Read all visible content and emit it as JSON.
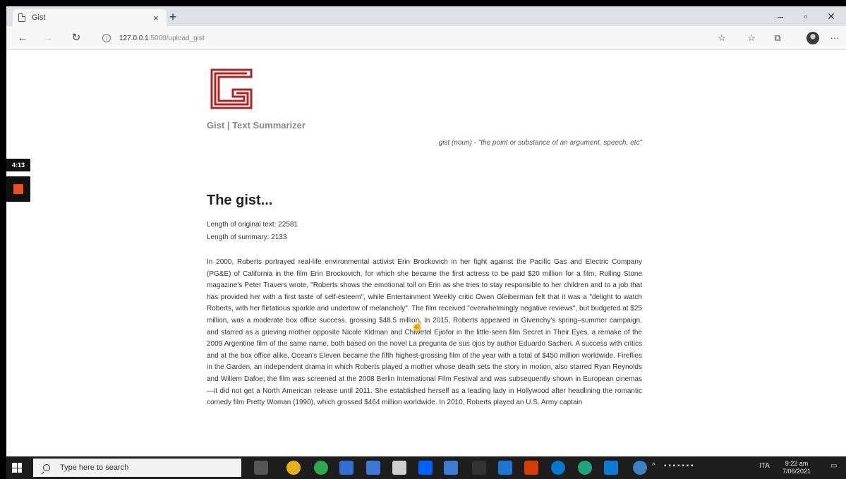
{
  "browser": {
    "tab_title": "Gist",
    "tab_close": "×",
    "new_tab": "+",
    "url_host": "127.0.0.1",
    "url_path": ":5000/upload_gist",
    "window_controls": {
      "minimize": "–",
      "restore": "▫",
      "close": "✕"
    }
  },
  "page": {
    "site_title": "Gist | Text Summarizer",
    "tagline": "gist (noun) - \"the point or substance of an argument, speech, etc\"",
    "heading": "The gist...",
    "original_length_label": "Length of original text: 22581",
    "summary_length_label": "Length of summary: 2133",
    "summary": "In 2000, Roberts portrayed real-life environmental activist Erin Brockovich in her fight against the Pacific Gas and Electric Company (PG&E) of California in the film Erin Brockovich, for which she became the first actress to be paid $20 million for a film; Rolling Stone magazine's Peter Travers wrote, \"Roberts shows the emotional toll on Erin as she tries to stay responsible to her children and to a job that has provided her with a first taste of self-esteem\", while Entertainment Weekly critic Owen Gleiberman felt that it was a \"delight to watch Roberts, with her flirtatious sparkle and undertow of melancholy\". The film received \"overwhelmingly negative reviews\", but budgeted at $25 million, was a moderate box office success, grossing $48.5 million. In 2015, Roberts appeared in Givenchy's spring–summer campaign, and starred as a grieving mother opposite Nicole Kidman and Chiwetel Ejiofor in the little-seen film Secret in Their Eyes, a remake of the 2009 Argentine film of the same name, both based on the novel La pregunta de sus ojos by author Eduardo Sacheri. A success with critics and at the box office alike, Ocean's Eleven became the fifth highest-grossing film of the year with a total of $450 million worldwide. Fireflies in the Garden, an independent drama in which Roberts played a mother whose death sets the story in motion, also starred Ryan Reynolds and Willem Dafoe; the film was screened at the 2008 Berlin International Film Festival and was subsequently shown in European cinemas—it did not get a North American release until 2011. She established herself as a leading lady in Hollywood after headlining the romantic comedy film Pretty Woman (1990), which grossed $464 million worldwide. In 2010, Roberts played an U.S. Army captain"
  },
  "recorder": {
    "timer": "4:13"
  },
  "taskbar": {
    "search_placeholder": "Type here to search",
    "language": "ITA",
    "time": "9:22 am",
    "date": "7/06/2021"
  },
  "colors": {
    "logo": "#b22222",
    "recorder_stop": "#e8501e"
  }
}
